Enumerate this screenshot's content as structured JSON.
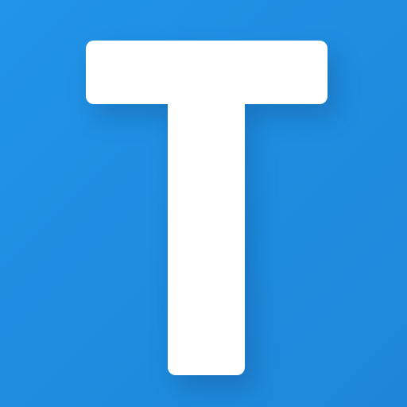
{
  "icon": {
    "name": "app-logo-icon",
    "letter": "T",
    "background_color": "#2391E6",
    "background_color_light": "#2194E8",
    "background_color_dark": "#1E86D8",
    "glyph_color": "#FFFFFF",
    "shadow_color": "#0A4A86"
  }
}
